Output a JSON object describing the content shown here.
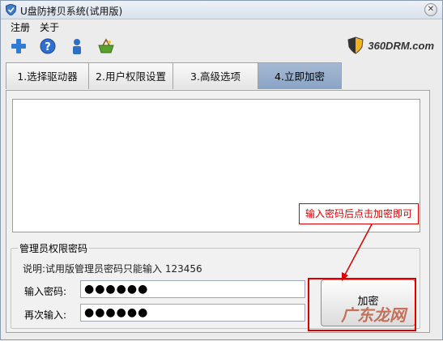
{
  "window": {
    "title": "U盘防拷贝系统(试用版)"
  },
  "menu": [
    "注册",
    "关于"
  ],
  "toolbar": {
    "icons": [
      "add-icon",
      "help-icon",
      "user-icon",
      "basket-icon"
    ]
  },
  "brand": {
    "logo_text": "360DRM.com"
  },
  "tabs": [
    {
      "label": "1.选择驱动器",
      "active": false
    },
    {
      "label": "2.用户权限设置",
      "active": false
    },
    {
      "label": "3.高级选项",
      "active": false
    },
    {
      "label": "4.立即加密",
      "active": true
    }
  ],
  "password_group": {
    "legend": "管理员权限密码",
    "note": "说明:试用版管理员密码只能输入 123456",
    "input_label": "输入密码:",
    "input_value": "●●●●●●",
    "confirm_label": "再次输入:",
    "confirm_value": "●●●●●●",
    "encrypt_button": "加密"
  },
  "annotation": {
    "callout": "输入密码后点击加密即可"
  },
  "watermark": "广东龙网",
  "colors": {
    "annotation_red": "#dd0000",
    "active_tab": "#8aa4c6"
  }
}
